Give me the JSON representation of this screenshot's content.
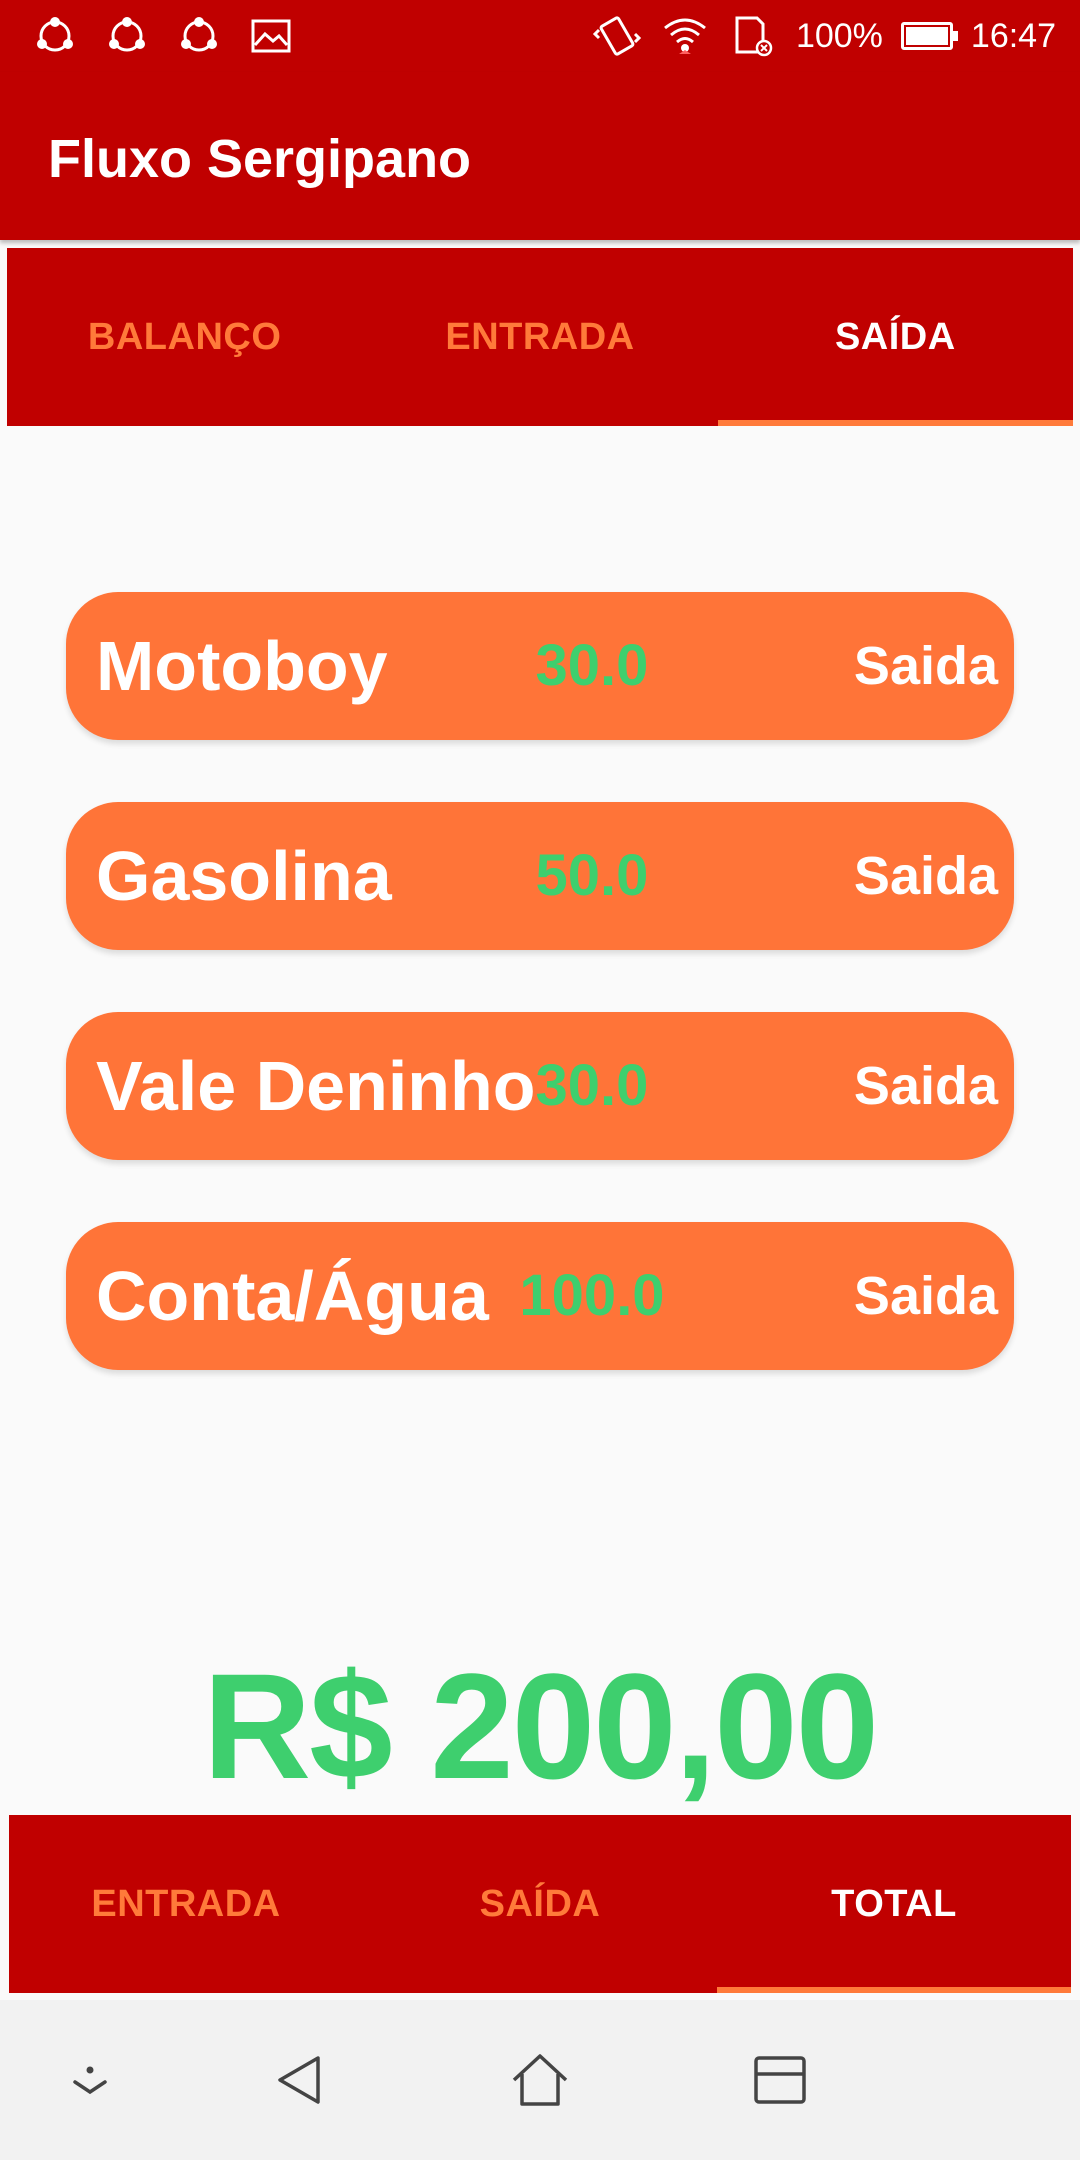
{
  "status_bar": {
    "icons": [
      "share-icon",
      "share-icon",
      "share-icon",
      "image-icon",
      "vibrate-icon",
      "wifi-icon",
      "sd-card-icon",
      "battery-icon"
    ],
    "battery": "100%",
    "battery_level": 1.0,
    "time": "16:47"
  },
  "app": {
    "title": "Fluxo Sergipano"
  },
  "top_tabs": [
    {
      "label": "BALANÇO",
      "active": false
    },
    {
      "label": "ENTRADA",
      "active": false
    },
    {
      "label": "SAÍDA",
      "active": true
    }
  ],
  "items": [
    {
      "name": "Motoboy",
      "value": "30.0",
      "type": "Saida"
    },
    {
      "name": "Gasolina",
      "value": "50.0",
      "type": "Saida"
    },
    {
      "name": "Vale Deninho",
      "value": "30.0",
      "type": "Saida"
    },
    {
      "name": "Conta/Água",
      "value": "100.0",
      "type": "Saida"
    }
  ],
  "total": "R$ 200,00",
  "bottom_tabs": [
    {
      "label": "ENTRADA",
      "active": false
    },
    {
      "label": "SAÍDA",
      "active": false
    },
    {
      "label": "TOTAL",
      "active": true
    }
  ],
  "nav_bar": {
    "icons": [
      "chevron-down-icon",
      "back-icon",
      "home-icon",
      "recents-icon"
    ]
  },
  "colors": {
    "primary": "#c00000",
    "accent": "#ff7438",
    "value_green": "#3ecf6e",
    "background": "#fafafa"
  }
}
